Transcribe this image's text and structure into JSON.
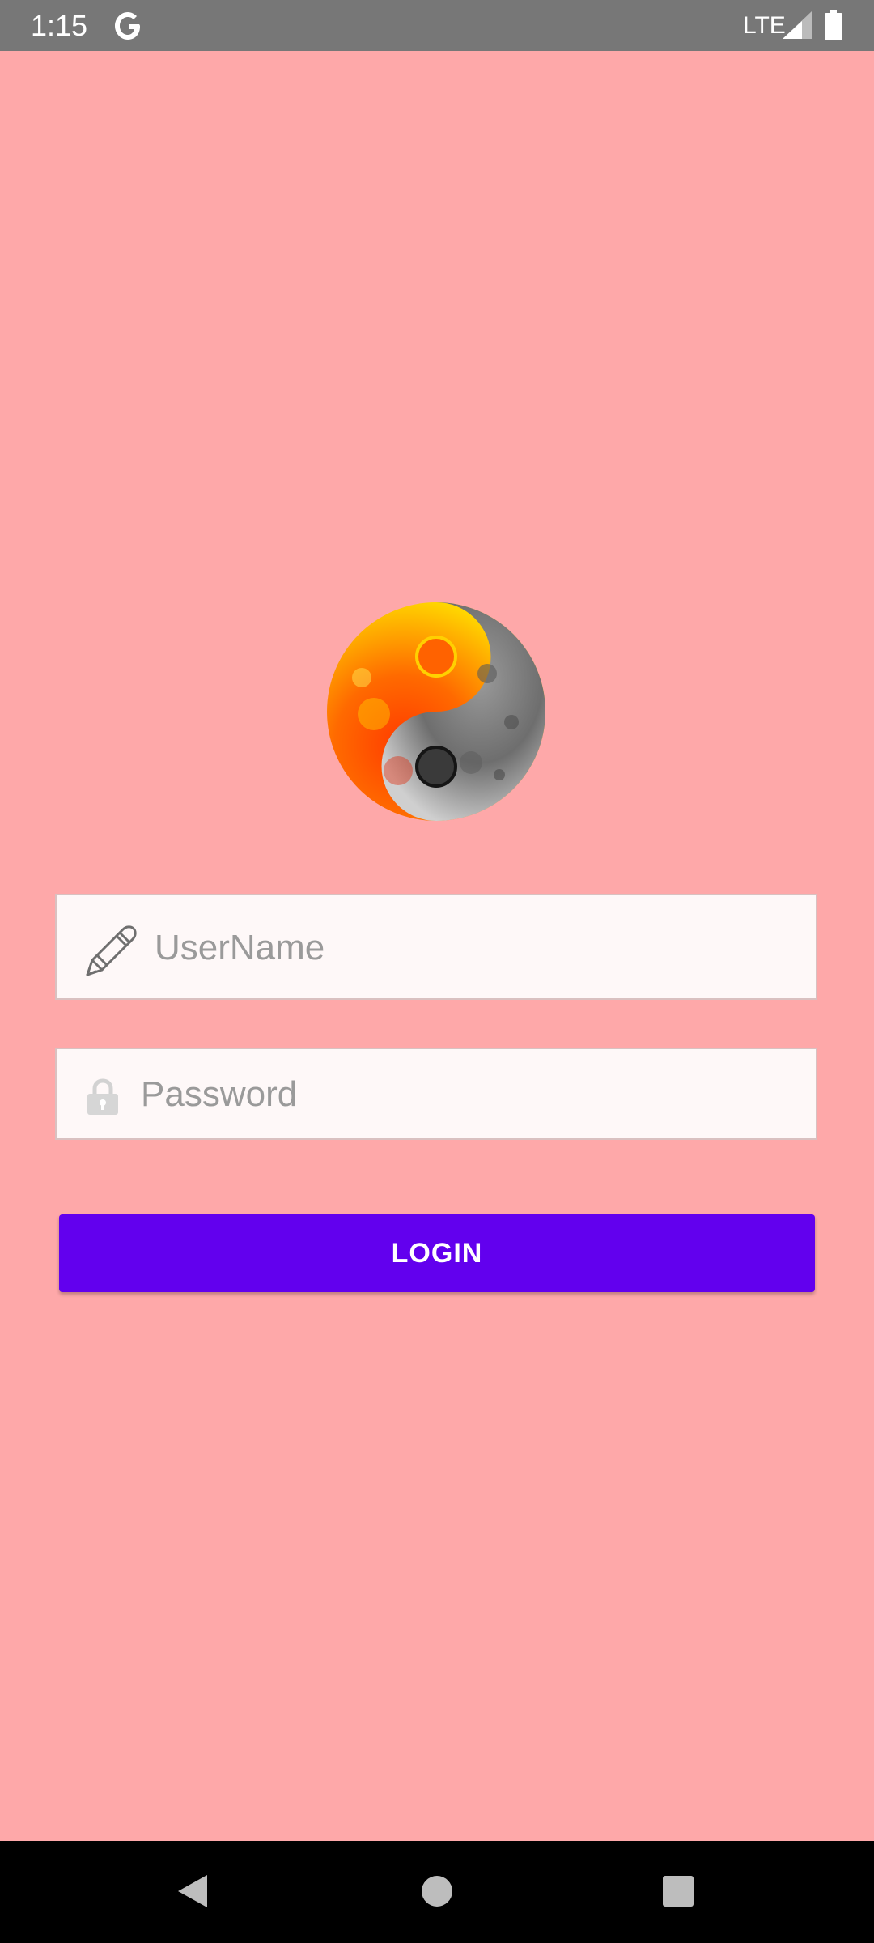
{
  "status_bar": {
    "time": "1:15",
    "google_letter": "G",
    "network": "LTE",
    "icons": [
      "google-icon",
      "signal-icon",
      "battery-icon"
    ]
  },
  "logo": {
    "icon": "yin-yang-logo"
  },
  "login_form": {
    "username": {
      "placeholder": "UserName",
      "value": "",
      "icon": "pencil-icon"
    },
    "password": {
      "placeholder": "Password",
      "value": "",
      "icon": "lock-icon"
    },
    "login_label": "LOGIN"
  },
  "nav_bar": {
    "icons": [
      "back-icon",
      "home-icon",
      "recents-icon"
    ]
  },
  "colors": {
    "background": "#fea8a9",
    "status_bar": "#777777",
    "field_background": "#fef8f8",
    "field_border": "#d9c1c1",
    "placeholder_text": "#9a9a9a",
    "button": "#6200ee",
    "button_text": "#ffffff",
    "nav_bar": "#000000"
  }
}
